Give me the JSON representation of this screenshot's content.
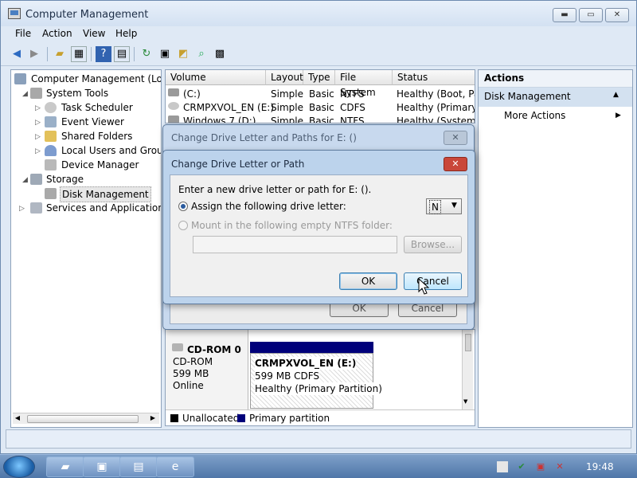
{
  "window": {
    "title": "Computer Management",
    "min_glyph": "▬",
    "max_glyph": "▭",
    "close_glyph": "✕"
  },
  "menu": [
    "File",
    "Action",
    "View",
    "Help"
  ],
  "toolbar_icons": [
    "back-icon",
    "forward-icon",
    "up-folder-icon",
    "show-hide-tree-icon",
    "help-icon",
    "properties-icon",
    "refresh-icon",
    "export-icon",
    "open-icon",
    "find-icon",
    "settings-icon"
  ],
  "tree": {
    "root": "Computer Management (Local",
    "system_tools": "System Tools",
    "task_scheduler": "Task Scheduler",
    "event_viewer": "Event Viewer",
    "shared_folders": "Shared Folders",
    "local_users": "Local Users and Groups",
    "device_manager": "Device Manager",
    "storage": "Storage",
    "disk_management": "Disk Management",
    "services": "Services and Applications"
  },
  "volume_table": {
    "headers": [
      "Volume",
      "Layout",
      "Type",
      "File System",
      "Status"
    ],
    "rows": [
      {
        "volume": "(C:)",
        "layout": "Simple",
        "type": "Basic",
        "fs": "NTFS",
        "status": "Healthy (Boot, Pag"
      },
      {
        "volume": "CRMPXVOL_EN (E:)",
        "layout": "Simple",
        "type": "Basic",
        "fs": "CDFS",
        "status": "Healthy (Primary P"
      },
      {
        "volume": "Windows 7 (D:)",
        "layout": "Simple",
        "type": "Basic",
        "fs": "NTFS",
        "status": "Healthy (System, A"
      }
    ]
  },
  "disk_view": {
    "disk_name": "CD-ROM 0",
    "disk_type": "CD-ROM",
    "disk_size": "599 MB",
    "disk_state": "Online",
    "partition_name": "CRMPXVOL_EN  (E:)",
    "partition_size": "599 MB CDFS",
    "partition_status": "Healthy (Primary Partition)"
  },
  "legend": {
    "unallocated": "Unallocated",
    "primary": "Primary partition"
  },
  "actions": {
    "header": "Actions",
    "selected": "Disk Management",
    "more": "More Actions"
  },
  "outer_dialog": {
    "title": "Change Drive Letter and Paths for E: ()",
    "ok": "OK",
    "cancel": "Cancel"
  },
  "inner_dialog": {
    "title": "Change Drive Letter or Path",
    "prompt": "Enter a new drive letter or path for E: ().",
    "assign_label": "Assign the following drive letter:",
    "drive_letter_value": "N",
    "mount_label": "Mount in the following empty NTFS folder:",
    "mount_path_value": "",
    "browse": "Browse...",
    "ok": "OK",
    "cancel": "Cancel"
  },
  "taskbar": {
    "clock": "19:48"
  },
  "colors": {
    "unallocated": "#000000",
    "primary_partition": "#00007a",
    "dialog_close": "#c9473a"
  }
}
